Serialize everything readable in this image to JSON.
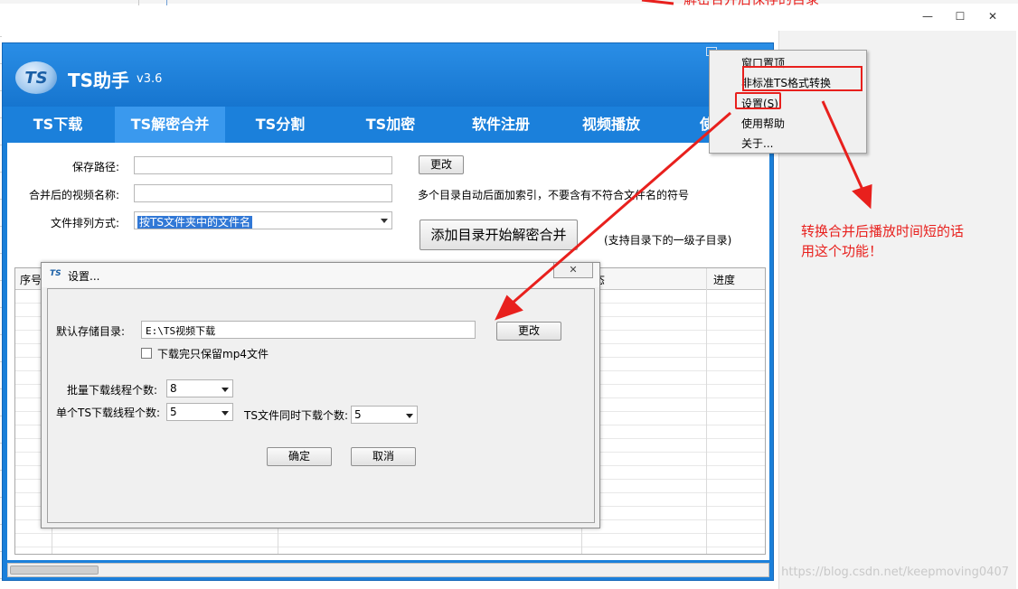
{
  "background": {
    "window_controls": [
      "—",
      "☐",
      "✕"
    ],
    "top_note": "解密合并后保存的目录"
  },
  "app": {
    "logo_text": "TS",
    "title": "TS助手",
    "version": "v3.6",
    "tabs": [
      {
        "label": "TS下载"
      },
      {
        "label": "TS解密合并"
      },
      {
        "label": "TS分割"
      },
      {
        "label": "TS加密"
      },
      {
        "label": "软件注册"
      },
      {
        "label": "视频播放"
      },
      {
        "label": "使"
      }
    ],
    "form": {
      "save_path_label": "保存路径:",
      "save_path_value": "",
      "change_button": "更改",
      "merged_name_label": "合并后的视频名称:",
      "merged_name_value": "",
      "merged_name_hint": "多个目录自动后面加索引，不要含有不符合文件名的符号",
      "sort_label": "文件排列方式:",
      "sort_value": "按TS文件夹中的文件名",
      "start_button": "添加目录开始解密合并",
      "start_hint": "(支持目录下的一级子目录)"
    },
    "grid": {
      "columns": [
        "序号",
        "态",
        "进度"
      ]
    }
  },
  "context_menu": {
    "items": [
      "窗口置顶",
      "非标准TS格式转换",
      "设置(S)",
      "使用帮助",
      "关于..."
    ]
  },
  "settings_dialog": {
    "icon_text": "TS",
    "title": "设置...",
    "close_glyph": "✕",
    "default_dir_label": "默认存储目录:",
    "default_dir_value": "E:\\TS视频下载",
    "change_button": "更改",
    "keep_mp4_label": "下载完只保留mp4文件",
    "keep_mp4_checked": false,
    "batch_threads_label": "批量下载线程个数:",
    "batch_threads_value": "8",
    "single_threads_label": "单个TS下载线程个数:",
    "single_threads_value": "5",
    "concurrent_label": "TS文件同时下载个数:",
    "concurrent_value": "5",
    "ok_button": "确定",
    "cancel_button": "取消"
  },
  "annotations": {
    "side_note_line1": "转换合并后播放时间短的话",
    "side_note_line2": "用这个功能！",
    "color": "#e8201d"
  },
  "watermark": "https://blog.csdn.net/keepmoving0407"
}
